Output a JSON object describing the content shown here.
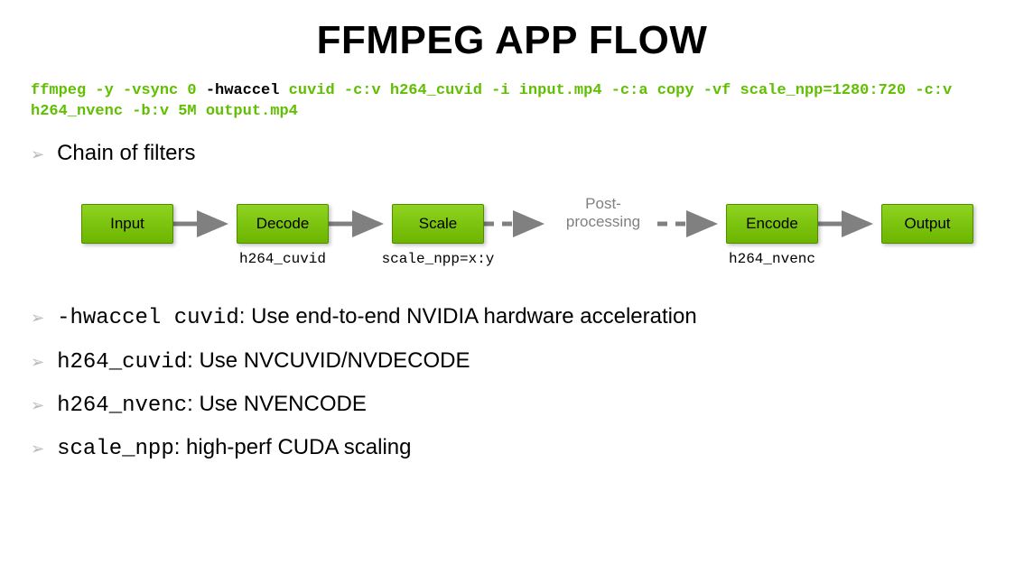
{
  "title": "FFMPEG APP FLOW",
  "command": {
    "pre": "ffmpeg -y -vsync 0 ",
    "hw": "-hwaccel",
    "post": " cuvid -c:v h264_cuvid -i input.mp4 -c:a copy -vf scale_npp=1280:720 -c:v h264_nvenc -b:v 5M output.mp4"
  },
  "bullets": {
    "chain": "Chain of filters",
    "hwaccel_code": "-hwaccel cuvid",
    "hwaccel_text": ": Use end-to-end NVIDIA hardware acceleration",
    "cuvid_code": "h264_cuvid",
    "cuvid_text": ": Use NVCUVID/NVDECODE",
    "nvenc_code": "h264_nvenc",
    "nvenc_text": ": Use NVENCODE",
    "snpp_code": "scale_npp",
    "snpp_text": ": high-perf CUDA scaling"
  },
  "flow": {
    "nodes": {
      "input": "Input",
      "decode": "Decode",
      "scale": "Scale",
      "encode": "Encode",
      "output": "Output"
    },
    "pp": "Post-\nprocessing",
    "captions": {
      "decode": "h264_cuvid",
      "scale": "scale_npp=x:y",
      "encode": "h264_nvenc"
    }
  }
}
